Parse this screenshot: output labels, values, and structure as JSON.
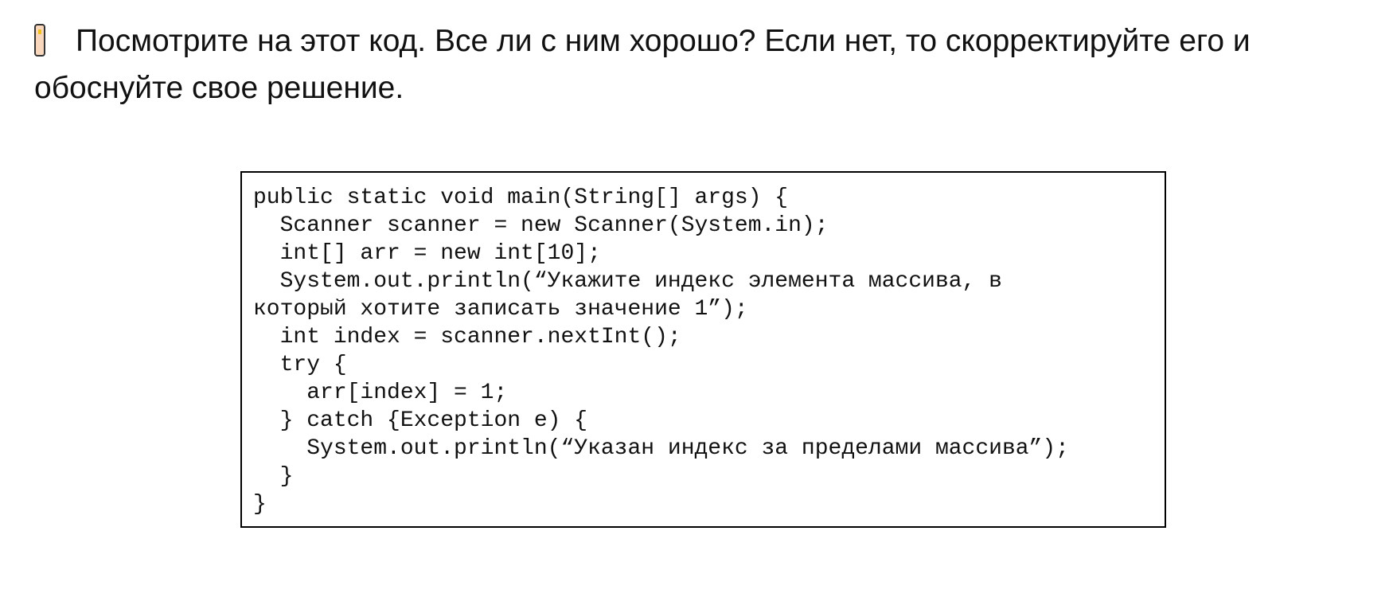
{
  "question": {
    "icon": "mobile-phone-icon",
    "text": "Посмотрите на этот код. Все ли с ним хорошо? Если нет, то скорректируйте его и обоснуйте свое решение."
  },
  "code": {
    "lines": [
      "public static void main(String[] args) {",
      "  Scanner scanner = new Scanner(System.in);",
      "  int[] arr = new int[10];",
      "  System.out.println(“Укажите индекс элемента массива, в",
      "который хотите записать значение 1”);",
      "  int index = scanner.nextInt();",
      "  try {",
      "    arr[index] = 1;",
      "  } catch {Exception e) {",
      "    System.out.println(“Указан индекс за пределами массива”);",
      "  }",
      "}"
    ]
  }
}
